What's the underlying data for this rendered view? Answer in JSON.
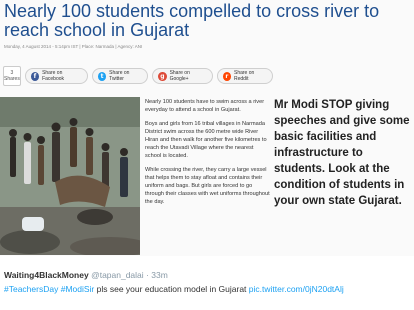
{
  "article": {
    "headline": "Nearly 100 students compelled to cross river to reach school in Gujarat",
    "meta": "Monday, 4 August 2014 - 5:14pm IST | Place: Narmada | Agency: ANI",
    "share_count": "3",
    "share_count_label": "Shares",
    "share_buttons": [
      {
        "label": "Share on Facebook",
        "icon": "facebook-icon",
        "color": "#3b5998",
        "glyph": "f"
      },
      {
        "label": "Share on Twitter",
        "icon": "twitter-icon",
        "color": "#1da1f2",
        "glyph": "t"
      },
      {
        "label": "Share on Google+",
        "icon": "google-plus-icon",
        "color": "#dd4b39",
        "glyph": "g"
      },
      {
        "label": "Share on Reddit",
        "icon": "reddit-icon",
        "color": "#ff4500",
        "glyph": "r"
      }
    ],
    "paragraphs": [
      "Nearly 100 students have to swim across a river everyday to attend a school in Gujarat.",
      "Boys and girls from 16 tribal villages in Narmada District swim across the 600 metre wide River Hiran and then walk for another five kilometres to reach the Utavadi Village where the nearest school is located.",
      "While crossing the river, they carry a large vessel that helps them to stay afloat and contains their uniform and bags. But girls are forced to go through their classes with wet uniforms throughout the day."
    ]
  },
  "overlay_text": "Mr Modi STOP giving speeches and give some basic facilities and infrastructure to students. Look at the condition of students in your own state Gujarat.",
  "tweet": {
    "name": "Waiting4BlackMoney",
    "handle": "@tapan_dalai",
    "time": "33m",
    "hashtag1": "#TeachersDay",
    "hashtag2": "#ModiSir",
    "body": " pls see your education model in Gujarat ",
    "link": "pic.twitter.com/0jN20dtAlj"
  }
}
